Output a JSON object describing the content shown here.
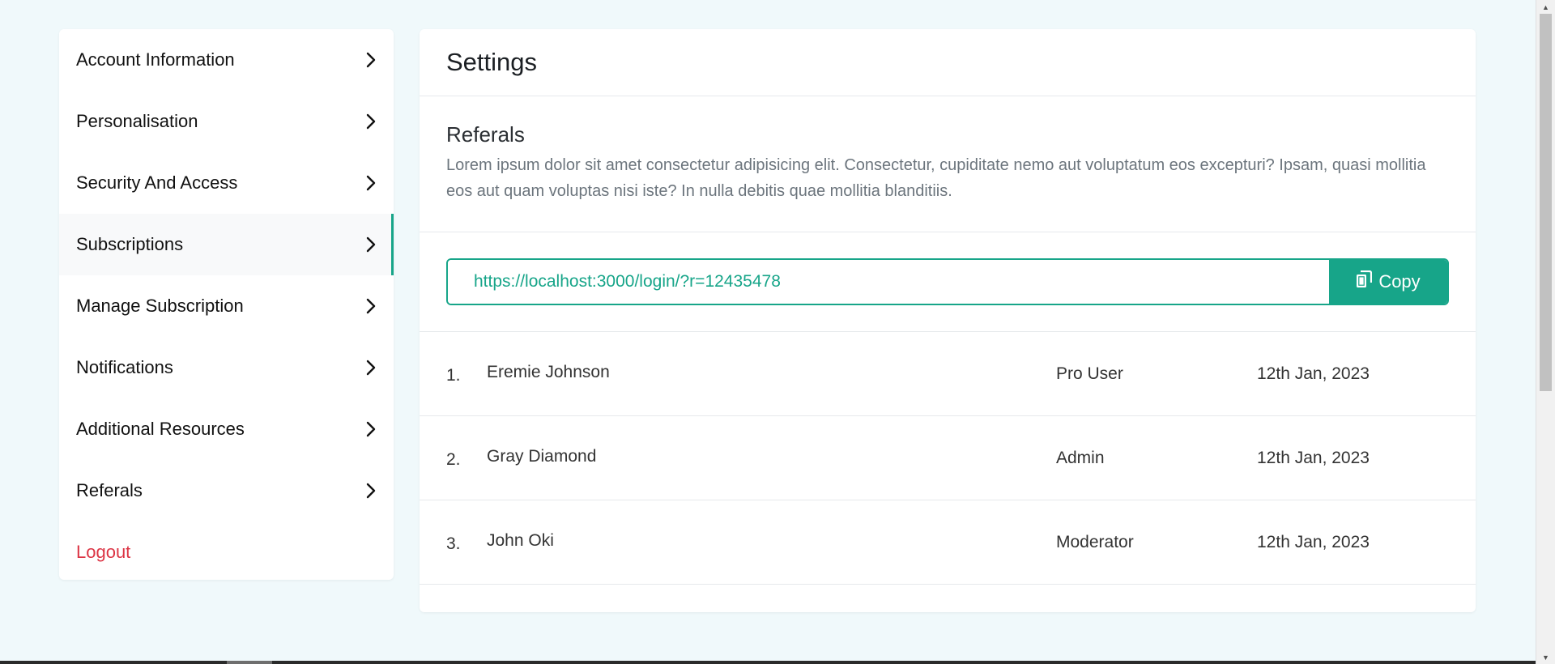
{
  "sidebar": {
    "items": [
      {
        "label": "Account Information"
      },
      {
        "label": "Personalisation"
      },
      {
        "label": "Security And Access"
      },
      {
        "label": "Subscriptions",
        "active": true
      },
      {
        "label": "Manage Subscription"
      },
      {
        "label": "Notifications"
      },
      {
        "label": "Additional Resources"
      },
      {
        "label": "Referals"
      }
    ],
    "logout_label": "Logout"
  },
  "main": {
    "title": "Settings",
    "section_title": "Referals",
    "section_description": "Lorem ipsum dolor sit amet consectetur adipisicing elit. Consectetur, cupiditate nemo aut voluptatum eos excepturi? Ipsam, quasi mollitia eos aut quam voluptas nisi iste? In nulla debitis quae mollitia blanditiis.",
    "referral_link": "https://localhost:3000/login/?r=12435478",
    "copy_label": "Copy",
    "referrals": [
      {
        "index": "1.",
        "name": "Eremie Johnson",
        "role": "Pro User",
        "date": "12th Jan, 2023"
      },
      {
        "index": "2.",
        "name": "Gray Diamond",
        "role": "Admin",
        "date": "12th Jan, 2023"
      },
      {
        "index": "3.",
        "name": "John Oki",
        "role": "Moderator",
        "date": "12th Jan, 2023"
      }
    ]
  },
  "colors": {
    "accent": "#17a589",
    "logout": "#dc3545",
    "background": "#f0f9fb"
  },
  "icons": {
    "chevron": "chevron-right-icon",
    "copy": "copy-icon"
  }
}
